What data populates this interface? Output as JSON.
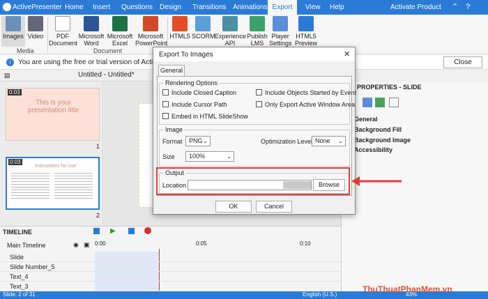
{
  "app": {
    "name": "ActivePresenter",
    "activate": "Activate Product",
    "menu_tabs": [
      "Home",
      "Insert",
      "Questions",
      "Design",
      "Transitions",
      "Animations",
      "Export",
      "View",
      "Help"
    ],
    "active_tab": "Export"
  },
  "ribbon": {
    "buttons": [
      {
        "label": "Images",
        "icon": "images-icon"
      },
      {
        "label": "Video",
        "icon": "video-icon"
      },
      {
        "label": "PDF Document",
        "icon": "pdf-icon"
      },
      {
        "label": "Microsoft Word",
        "icon": "word-icon"
      },
      {
        "label": "Microsoft Excel",
        "icon": "excel-icon"
      },
      {
        "label": "Microsoft PowerPoint",
        "icon": "powerpoint-icon"
      },
      {
        "label": "HTML5",
        "icon": "html5-icon"
      },
      {
        "label": "SCORM",
        "icon": "scorm-icon"
      },
      {
        "label": "Experience API",
        "icon": "xapi-icon"
      },
      {
        "label": "Publish LMS",
        "icon": "publish-icon"
      },
      {
        "label": "Player Settings",
        "icon": "player-settings-icon"
      },
      {
        "label": "HTML5 Preview",
        "icon": "html5-preview-icon"
      }
    ],
    "groups": [
      "Media",
      "Document"
    ]
  },
  "notice": {
    "text": "You are using the free or trial version of ActivePresenter",
    "close_label": "Close"
  },
  "doc_tab": "Untitled - Untitled*",
  "slides": [
    {
      "number": "1",
      "time": "0:03",
      "title": "This is your presentation title"
    },
    {
      "number": "2",
      "time": "0:03",
      "title": "Instructions for use"
    }
  ],
  "right_panel": {
    "title": "PROPERTIES - SLIDE",
    "items": [
      "General",
      "Background Fill",
      "Background Image",
      "Accessibility"
    ]
  },
  "timeline": {
    "title": "TIMELINE",
    "main": "Main Timeline",
    "ticks": [
      "0:00",
      "0:05",
      "0:10"
    ],
    "rows": [
      "Slide",
      "Slide Number_5",
      "Text_4",
      "Text_3"
    ]
  },
  "status": {
    "slide": "Slide: 2 of 31",
    "lang": "English (U.S.)",
    "zoom": "43%",
    "watermark": "ThuThuatPhanMem.vn"
  },
  "dialog": {
    "title": "Export To Images",
    "tab": "General",
    "rendering_legend": "Rendering Options",
    "checks_left": [
      "Include Closed Caption",
      "Include Cursor Path",
      "Embed in HTML SlideShow"
    ],
    "checks_right": [
      "Include Objects Started by Event",
      "Only Export Active Window Area"
    ],
    "image_legend": "Image",
    "format_label": "Format",
    "format_value": "PNG",
    "opt_label": "Optimization Level",
    "opt_value": "None",
    "size_label": "Size",
    "size_value": "100%",
    "output_legend": "Output",
    "location_label": "Location",
    "browse": "Browse",
    "ok": "OK",
    "cancel": "Cancel"
  },
  "colors": {
    "accent": "#2b7bd6",
    "highlight": "#e53a3a"
  }
}
